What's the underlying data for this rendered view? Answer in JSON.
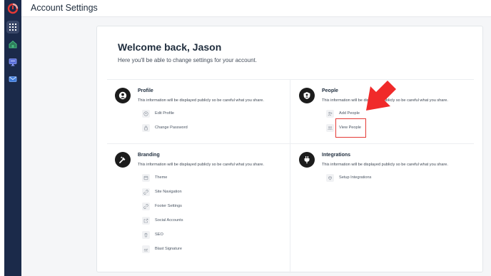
{
  "header": {
    "title": "Account Settings"
  },
  "welcome": {
    "title": "Welcome back, Jason",
    "subtitle": "Here you'll be able to change settings for your account."
  },
  "sections": {
    "profile": {
      "title": "Profile",
      "description": "This information will be displayed publicly so be careful what you share.",
      "items": [
        "Edit Profile",
        "Change Password"
      ]
    },
    "people": {
      "title": "People",
      "description": "This information will be displayed publicly so be careful what you share.",
      "items": [
        "Add People",
        "View People"
      ]
    },
    "branding": {
      "title": "Branding",
      "description": "This information will be displayed publicly so be careful what you share.",
      "items": [
        "Theme",
        "Site Navigation",
        "Footer Settings",
        "Social Accounts",
        "SEO",
        "Blast Signature"
      ]
    },
    "integrations": {
      "title": "Integrations",
      "description": "This information will be displayed publicly so be careful what you share.",
      "items": [
        "Setup Integrations"
      ]
    }
  },
  "colors": {
    "sidebar": "#1b2a4a",
    "brand": "#e53935",
    "highlight": "#e53935"
  }
}
